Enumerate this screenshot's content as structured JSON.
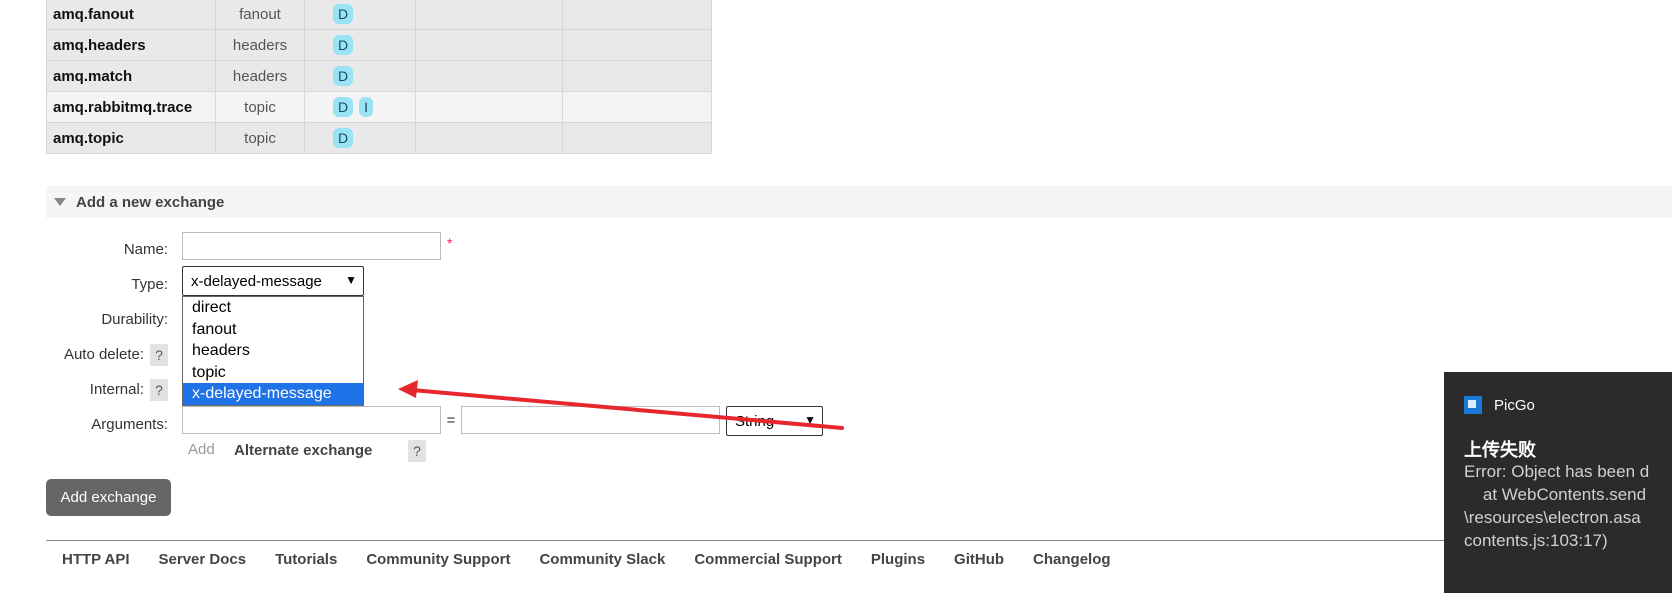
{
  "exchanges": [
    {
      "name": "amq.fanout",
      "type": "fanout",
      "features": [
        "D"
      ]
    },
    {
      "name": "amq.headers",
      "type": "headers",
      "features": [
        "D"
      ]
    },
    {
      "name": "amq.match",
      "type": "headers",
      "features": [
        "D"
      ]
    },
    {
      "name": "amq.rabbitmq.trace",
      "type": "topic",
      "features": [
        "D",
        "I"
      ]
    },
    {
      "name": "amq.topic",
      "type": "topic",
      "features": [
        "D"
      ]
    }
  ],
  "add_section": {
    "title": "Add a new exchange",
    "name_label": "Name:",
    "required_mark": "*",
    "type_label": "Type:",
    "type_selected": "x-delayed-message",
    "type_options": [
      "direct",
      "fanout",
      "headers",
      "topic",
      "x-delayed-message"
    ],
    "durability_label": "Durability:",
    "auto_delete_label": "Auto delete:",
    "internal_label": "Internal:",
    "arguments_label": "Arguments:",
    "help": "?",
    "equals": "=",
    "arg_type_selected": "String",
    "add_link": "Add",
    "alternate_exchange": "Alternate exchange",
    "submit": "Add exchange"
  },
  "footer": [
    "HTTP API",
    "Server Docs",
    "Tutorials",
    "Community Support",
    "Community Slack",
    "Commercial Support",
    "Plugins",
    "GitHub",
    "Changelog"
  ],
  "toast": {
    "app": "PicGo",
    "title": "上传失败",
    "lines": [
      "Error: Object has been d",
      "    at WebContents.send",
      "\\resources\\electron.asa",
      "contents.js:103:17)"
    ]
  },
  "colors": {
    "badge": "#99e3f5",
    "selected_option": "#1e73e8",
    "arrow": "#e8262e",
    "toast_bg": "#2b2b2b"
  }
}
